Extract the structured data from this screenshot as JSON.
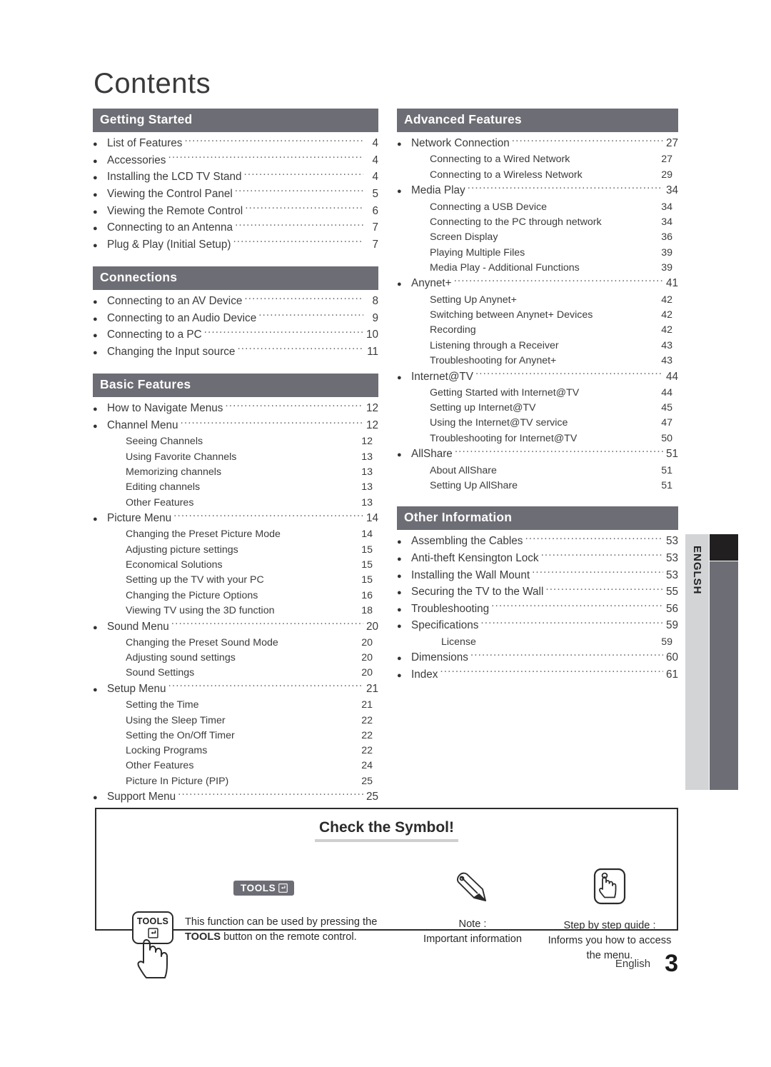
{
  "page": {
    "title": "Contents",
    "side_tab_label": "ENGLSH",
    "footer_language": "English",
    "footer_page_number": "3"
  },
  "colors": {
    "section_bar": "#6d6d75",
    "side_tab_light": "#d2d4d6",
    "side_tab_dark": "#211f20",
    "title_underline": "#cfcfcf"
  },
  "left_column": [
    {
      "heading": "Getting Started",
      "entries": [
        {
          "level": 1,
          "title": "List of Features",
          "page": "4"
        },
        {
          "level": 1,
          "title": "Accessories",
          "page": "4"
        },
        {
          "level": 1,
          "title": "Installing the LCD TV Stand",
          "page": "4"
        },
        {
          "level": 1,
          "title": "Viewing the Control Panel",
          "page": "5"
        },
        {
          "level": 1,
          "title": "Viewing the Remote Control",
          "page": "6"
        },
        {
          "level": 1,
          "title": "Connecting to an Antenna",
          "page": "7"
        },
        {
          "level": 1,
          "title": "Plug & Play (Initial Setup)",
          "page": "7"
        }
      ]
    },
    {
      "heading": "Connections",
      "entries": [
        {
          "level": 1,
          "title": "Connecting to an AV Device",
          "page": "8"
        },
        {
          "level": 1,
          "title": "Connecting to an Audio Device",
          "page": "9"
        },
        {
          "level": 1,
          "title": "Connecting to a PC",
          "page": "10"
        },
        {
          "level": 1,
          "title": "Changing the Input source",
          "page": "11"
        }
      ]
    },
    {
      "heading": "Basic Features",
      "entries": [
        {
          "level": 1,
          "title": "How to Navigate Menus",
          "page": "12"
        },
        {
          "level": 1,
          "title": "Channel Menu",
          "page": "12"
        },
        {
          "level": 2,
          "title": "Seeing Channels",
          "page": "12"
        },
        {
          "level": 2,
          "title": "Using Favorite Channels",
          "page": "13"
        },
        {
          "level": 2,
          "title": "Memorizing channels",
          "page": "13"
        },
        {
          "level": 2,
          "title": "Editing channels",
          "page": "13"
        },
        {
          "level": 2,
          "title": "Other Features",
          "page": "13"
        },
        {
          "level": 1,
          "title": "Picture Menu",
          "page": "14"
        },
        {
          "level": 2,
          "title": "Changing the Preset Picture Mode",
          "page": "14"
        },
        {
          "level": 2,
          "title": "Adjusting picture settings",
          "page": "15"
        },
        {
          "level": 2,
          "title": "Economical Solutions",
          "page": "15"
        },
        {
          "level": 2,
          "title": "Setting up the TV with your PC",
          "page": "15"
        },
        {
          "level": 2,
          "title": "Changing the Picture Options",
          "page": "16"
        },
        {
          "level": 2,
          "title": "Viewing TV using the 3D function",
          "page": "18"
        },
        {
          "level": 1,
          "title": "Sound Menu",
          "page": "20"
        },
        {
          "level": 2,
          "title": "Changing the Preset Sound Mode",
          "page": "20"
        },
        {
          "level": 2,
          "title": "Adjusting sound settings",
          "page": "20"
        },
        {
          "level": 2,
          "title": "Sound Settings",
          "page": "20"
        },
        {
          "level": 1,
          "title": "Setup Menu",
          "page": "21"
        },
        {
          "level": 2,
          "title": "Setting the Time",
          "page": "21"
        },
        {
          "level": 2,
          "title": "Using the Sleep Timer",
          "page": "22"
        },
        {
          "level": 2,
          "title": "Setting the On/Off Timer",
          "page": "22"
        },
        {
          "level": 2,
          "title": "Locking Programs",
          "page": "22"
        },
        {
          "level": 2,
          "title": "Other Features",
          "page": "24"
        },
        {
          "level": 2,
          "title": "Picture In Picture (PIP)",
          "page": "25"
        },
        {
          "level": 1,
          "title": "Support Menu",
          "page": "25"
        }
      ]
    }
  ],
  "right_column": [
    {
      "heading": "Advanced Features",
      "entries": [
        {
          "level": 1,
          "title": "Network Connection",
          "page": "27"
        },
        {
          "level": 2,
          "title": "Connecting to a Wired Network",
          "page": "27"
        },
        {
          "level": 2,
          "title": "Connecting to a Wireless Network",
          "page": "29"
        },
        {
          "level": 1,
          "title": "Media Play",
          "page": "34"
        },
        {
          "level": 2,
          "title": "Connecting a USB Device",
          "page": "34"
        },
        {
          "level": 2,
          "title": "Connecting to the PC through network",
          "page": "34"
        },
        {
          "level": 2,
          "title": "Screen Display",
          "page": "36"
        },
        {
          "level": 2,
          "title": "Playing Multiple Files",
          "page": "39"
        },
        {
          "level": 2,
          "title": "Media Play - Additional Functions",
          "page": "39"
        },
        {
          "level": 1,
          "title": "Anynet+",
          "page": "41"
        },
        {
          "level": 2,
          "title": "Setting Up Anynet+",
          "page": "42"
        },
        {
          "level": 2,
          "title": "Switching between Anynet+ Devices",
          "page": "42"
        },
        {
          "level": 2,
          "title": "Recording",
          "page": "42"
        },
        {
          "level": 2,
          "title": "Listening through a Receiver",
          "page": "43"
        },
        {
          "level": 2,
          "title": "Troubleshooting for Anynet+",
          "page": "43"
        },
        {
          "level": 1,
          "title": "Internet@TV",
          "page": "44"
        },
        {
          "level": 2,
          "title": "Getting Started with Internet@TV",
          "page": "44"
        },
        {
          "level": 2,
          "title": "Setting up Internet@TV",
          "page": "45"
        },
        {
          "level": 2,
          "title": "Using the Internet@TV service",
          "page": "47"
        },
        {
          "level": 2,
          "title": "Troubleshooting for Internet@TV",
          "page": "50"
        },
        {
          "level": 1,
          "title": "AllShare",
          "page": "51"
        },
        {
          "level": 2,
          "title": "About AllShare",
          "page": "51"
        },
        {
          "level": 2,
          "title": "Setting Up AllShare",
          "page": "51"
        }
      ]
    },
    {
      "heading": "Other Information",
      "entries": [
        {
          "level": 1,
          "title": "Assembling the Cables",
          "page": "53"
        },
        {
          "level": 1,
          "title": "Anti-theft Kensington Lock",
          "page": "53"
        },
        {
          "level": 1,
          "title": "Installing the Wall Mount",
          "page": "53"
        },
        {
          "level": 1,
          "title": "Securing the TV to the Wall",
          "page": "55"
        },
        {
          "level": 1,
          "title": "Troubleshooting",
          "page": "56"
        },
        {
          "level": 1,
          "title": "Specifications",
          "page": "59"
        },
        {
          "level": 3,
          "title": "License",
          "page": "59"
        },
        {
          "level": 1,
          "title": "Dimensions",
          "page": "60"
        },
        {
          "level": 1,
          "title": "Index",
          "page": "61"
        }
      ]
    }
  ],
  "symbol_box": {
    "title": "Check the Symbol!",
    "tools": {
      "badge_label": "TOOLS",
      "key_label": "TOOLS",
      "description_line1": "This function can be used by pressing the",
      "description_bold": "TOOLS",
      "description_line2_rest": " button on the remote control."
    },
    "note": {
      "caption_line1": "Note :",
      "caption_line2": "Important information"
    },
    "step": {
      "caption_line1": "Step by step guide :",
      "caption_line2": "Informs you how to access",
      "caption_line3": "the menu."
    }
  }
}
